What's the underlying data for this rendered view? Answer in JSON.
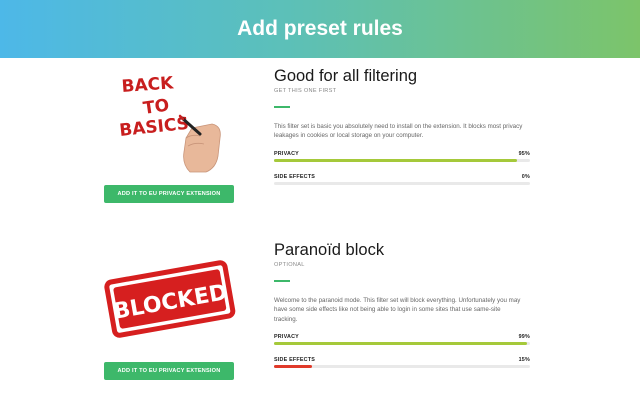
{
  "header": {
    "title": "Add preset rules"
  },
  "colors": {
    "accent_green": "#3db86a",
    "privacy_bar": "#a5c93a",
    "side_effects_bar": "#e03a2a",
    "header_gradient_start": "#4db8e8",
    "header_gradient_end": "#7cc46a"
  },
  "presets": [
    {
      "art_text_lines": [
        "BACK",
        "TO",
        "BASICS"
      ],
      "button_label": "ADD IT TO EU PRIVACY EXTENSION",
      "title": "Good for all filtering",
      "subtitle": "GET THIS ONE FIRST",
      "description": "This filter set is basic you absolutely need to install on the extension. It blocks most privacy leakages in cookies or local storage on your computer.",
      "privacy": {
        "label": "PRIVACY",
        "value": 95,
        "display": "95%"
      },
      "side_effects": {
        "label": "SIDE EFFECTS",
        "value": 0,
        "display": "0%"
      }
    },
    {
      "art_text_lines": [
        "BLOCKED"
      ],
      "button_label": "ADD IT TO EU PRIVACY EXTENSION",
      "title": "Paranoïd block",
      "subtitle": "OPTIONAL",
      "description": "Welcome to the paranoid mode. This filter set will block everything. Unfortunately you may have some side effects like not being able to login in some sites that use same-site tracking.",
      "privacy": {
        "label": "PRIVACY",
        "value": 99,
        "display": "99%"
      },
      "side_effects": {
        "label": "SIDE EFFECTS",
        "value": 15,
        "display": "15%"
      }
    }
  ]
}
